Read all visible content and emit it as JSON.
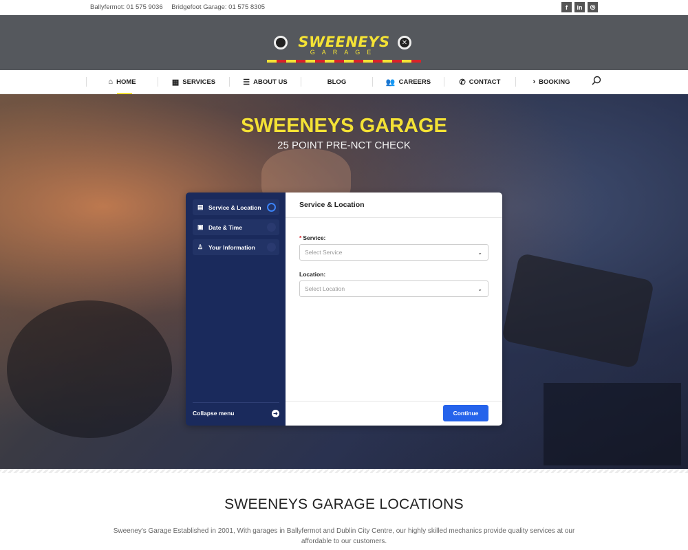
{
  "topbar": {
    "phone1": "Ballyfermot: 01 575 9036",
    "phone2": "Bridgefoot Garage: 01 575 8305",
    "socials": [
      {
        "icon": "facebook-icon",
        "glyph": "f"
      },
      {
        "icon": "linkedin-icon",
        "glyph": "in"
      },
      {
        "icon": "instagram-icon",
        "glyph": "◎"
      }
    ]
  },
  "logo": {
    "brand": "SWEENEYS",
    "sub": "GARAGE"
  },
  "nav": {
    "items": [
      {
        "label": "HOME",
        "icon": "home-icon",
        "glyph": "⌂"
      },
      {
        "label": "SERVICES",
        "icon": "grid-icon",
        "glyph": "▦"
      },
      {
        "label": "ABOUT US",
        "icon": "list-icon",
        "glyph": "☰"
      },
      {
        "label": "BLOG",
        "icon": "",
        "glyph": ""
      },
      {
        "label": "CAREERS",
        "icon": "users-icon",
        "glyph": "👥"
      },
      {
        "label": "CONTACT",
        "icon": "phone-icon",
        "glyph": "✆"
      },
      {
        "label": "BOOKING",
        "icon": "chevron-right-icon",
        "glyph": "›"
      }
    ]
  },
  "hero": {
    "title": "SWEENEYS GARAGE",
    "subtitle": "25 POINT PRE-NCT CHECK"
  },
  "booking": {
    "steps": [
      {
        "label": "Service & Location",
        "icon": "clipboard-icon",
        "glyph": "▤"
      },
      {
        "label": "Date & Time",
        "icon": "calendar-icon",
        "glyph": "▣"
      },
      {
        "label": "Your Information",
        "icon": "user-icon",
        "glyph": "♙"
      }
    ],
    "collapse_label": "Collapse menu",
    "panel_title": "Service & Location",
    "service_label": "Service:",
    "service_required": "*",
    "service_placeholder": "Select Service",
    "location_label": "Location:",
    "location_placeholder": "Select Location",
    "continue_label": "Continue"
  },
  "locations": {
    "title": "SWEENEYS GARAGE LOCATIONS",
    "text": "Sweeney's Garage Established in 2001, With garages in Ballyfermot and Dublin City Centre, our highly skilled mechanics provide quality services at our affordable to our customers."
  },
  "colors": {
    "accent_yellow": "#f4e235",
    "header_grey": "#55585d",
    "sidebar_navy": "#1a2a5c",
    "button_blue": "#2563eb"
  }
}
